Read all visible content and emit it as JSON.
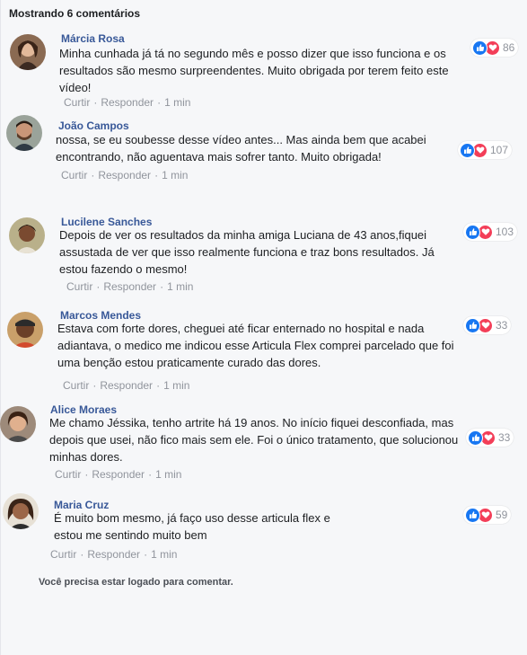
{
  "header": {
    "count_label": "Mostrando 6 comentários"
  },
  "actions": {
    "like": "Curtir",
    "reply": "Responder",
    "separator": "·"
  },
  "footer": {
    "login_note": "Você precisa estar logado para comentar."
  },
  "reaction_icons": [
    "like-icon",
    "love-icon"
  ],
  "colors": {
    "author": "#385898",
    "like": "#1877f2",
    "love": "#f33e58",
    "meta": "#90949c"
  },
  "comments": [
    {
      "author": "Márcia Rosa",
      "text": "Minha cunhada já tá no segundo mês e posso dizer que isso funciona e os resultados são mesmo surpreendentes. Muito obrigada por terem feito este vídeo!",
      "time": "1 min",
      "reactions": "86"
    },
    {
      "author": "João Campos",
      "text": "nossa, se eu soubesse desse vídeo antes... Mas ainda bem que acabei encontrando, não aguentava mais sofrer tanto. Muito obrigada!",
      "time": "1 min",
      "reactions": "107"
    },
    {
      "author": "Lucilene Sanches",
      "text": "Depois de ver os resultados da minha amiga Luciana de 43 anos,fiquei assustada de ver que isso realmente funciona e traz bons resultados. Já estou fazendo o mesmo!",
      "time": "1 min",
      "reactions": "103"
    },
    {
      "author": "Marcos Mendes",
      "text": "Estava com forte dores, cheguei até ficar enternado no hospital e nada adiantava, o medico me indicou esse Articula Flex comprei parcelado que foi uma benção estou praticamente curado das dores.",
      "time": "1 min",
      "reactions": "33"
    },
    {
      "author": "Alice Moraes",
      "text": "Me chamo Jéssika, tenho artrite há 19 anos. No início fiquei desconfiada, mas depois que usei, não fico mais sem ele. Foi o único tratamento, que solucionou minhas dores.",
      "time": "1 min",
      "reactions": "33"
    },
    {
      "author": "Maria Cruz",
      "text": "É muito bom mesmo, já faço uso desse articula flex e estou me sentindo muito bem",
      "time": "1 min",
      "reactions": "59"
    }
  ]
}
